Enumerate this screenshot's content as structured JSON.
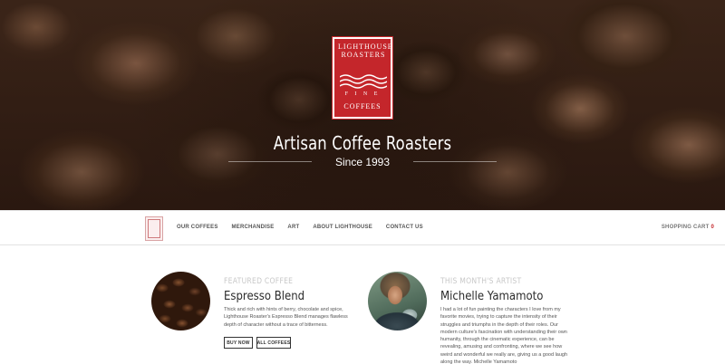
{
  "hero": {
    "logo": {
      "line1": "LIGHTHOUSE",
      "line2": "ROASTERS",
      "fine": "F I N E",
      "coffees": "COFFEES",
      "accent": "#c4262b"
    },
    "title": "Artisan Coffee Roasters",
    "subtitle": "Since 1993"
  },
  "nav": {
    "links": [
      "OUR COFFEES",
      "MERCHANDISE",
      "ART",
      "ABOUT LIGHTHOUSE",
      "CONTACT US"
    ],
    "cart_label": "SHOPPING CART",
    "cart_count": "0"
  },
  "featured": {
    "kicker": "FEATURED COFFEE",
    "title": "Espresso Blend",
    "body": "Thick and rich with hints of berry, chocolate and spice, Lighthouse Roaster's Espresso Blend manages flawless depth of character without a trace of bitterness.",
    "buy_label": "BUY NOW",
    "all_label": "ALL COFFEES"
  },
  "artist": {
    "kicker": "THIS MONTH'S ARTIST",
    "title": "Michelle Yamamoto",
    "body": "I had a lot of fun painting the characters I love from my favorite movies, trying to capture the intensity of their struggles and triumphs in the depth of their roles. Our modern culture's fascination with understanding their own humanity, through the cinematic experience, can be revealing, amusing and confronting, where we see how weird and wonderful we really are, giving us a good laugh along the way.  Michelle Yamamoto"
  }
}
